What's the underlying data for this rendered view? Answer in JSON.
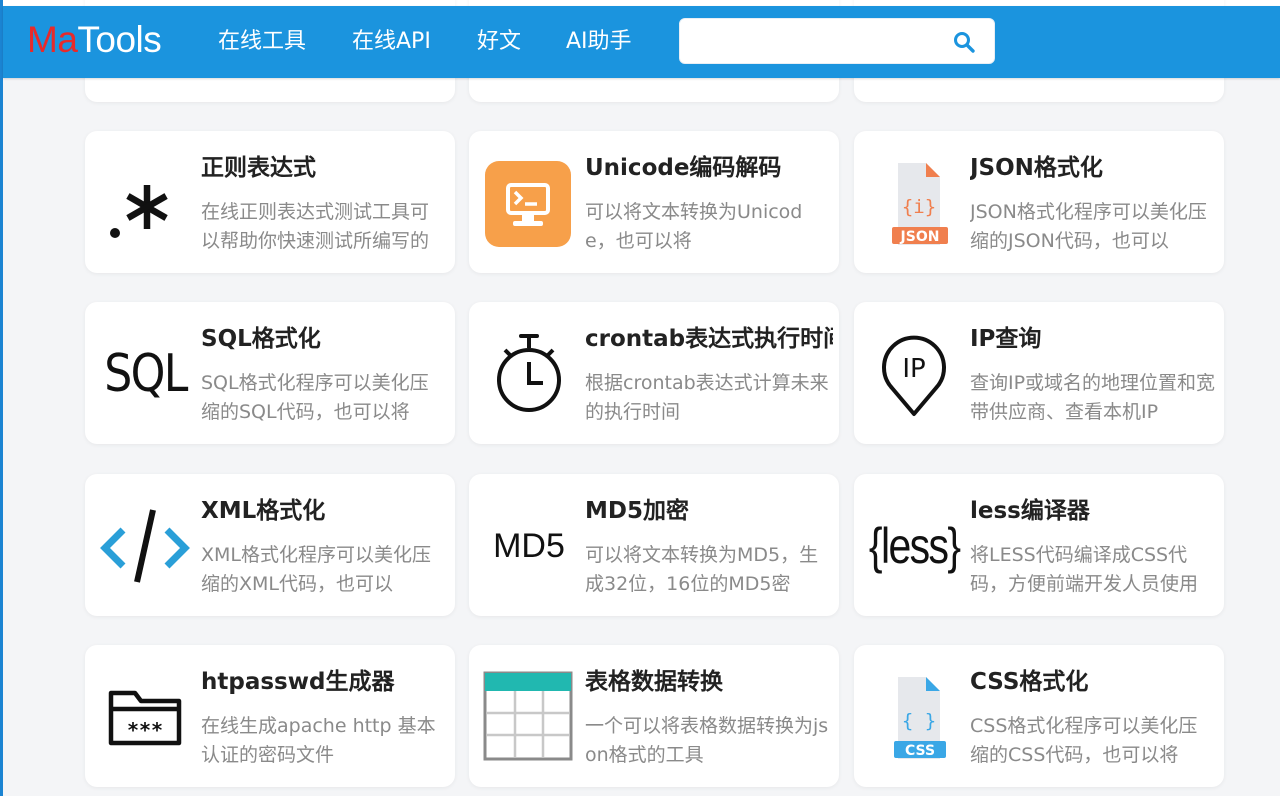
{
  "header": {
    "logo_ma": "Ma",
    "logo_tools": "Tools",
    "nav": [
      "在线工具",
      "在线API",
      "好文",
      "AI助手"
    ],
    "search": {
      "value": "",
      "placeholder": "",
      "icon": "search-icon"
    }
  },
  "partial_row": [
    "",
    "",
    ""
  ],
  "cards": [
    {
      "title": "正则表达式",
      "desc": "在线正则表达式测试工具可以帮助你快速测试所编写的",
      "icon": "regex-icon"
    },
    {
      "title": "Unicode编码解码",
      "desc": "可以将文本转换为Unicode，也可以将",
      "icon": "terminal-icon"
    },
    {
      "title": "JSON格式化",
      "desc": "JSON格式化程序可以美化压缩的JSON代码，也可以",
      "icon": "json-file-icon"
    },
    {
      "title": "SQL格式化",
      "desc": "SQL格式化程序可以美化压缩的SQL代码，也可以将",
      "icon": "sql-icon"
    },
    {
      "title": "crontab表达式执行时间",
      "desc": "根据crontab表达式计算未来的执行时间",
      "icon": "stopwatch-icon"
    },
    {
      "title": "IP查询",
      "desc": "查询IP或域名的地理位置和宽带供应商、查看本机IP",
      "icon": "ip-location-icon"
    },
    {
      "title": "XML格式化",
      "desc": "XML格式化程序可以美化压缩的XML代码，也可以",
      "icon": "xml-code-icon"
    },
    {
      "title": "MD5加密",
      "desc": "可以将文本转换为MD5，生成32位，16位的MD5密",
      "icon": "md5-icon"
    },
    {
      "title": "less编译器",
      "desc": "将LESS代码编译成CSS代码，方便前端开发人员使用",
      "icon": "less-icon"
    },
    {
      "title": "htpasswd生成器",
      "desc": "在线生成apache http 基本认证的密码文件",
      "icon": "password-folder-icon"
    },
    {
      "title": "表格数据转换",
      "desc": "一个可以将表格数据转换为json格式的工具",
      "icon": "table-icon"
    },
    {
      "title": "CSS格式化",
      "desc": "CSS格式化程序可以美化压缩的CSS代码，也可以将",
      "icon": "css-file-icon"
    }
  ],
  "icon_text": {
    "sql": "SQL",
    "md5": "MD5",
    "less": "{less}",
    "json_badge": "JSON",
    "json_glyph": "{i}",
    "css_badge": "CSS",
    "css_glyph": "{ }",
    "ip": "IP",
    "password": "***"
  },
  "colors": {
    "header": "#1b94de",
    "logo_accent": "#e82a2a",
    "orange": "#f7a04a",
    "json_orange": "#f07f4e",
    "css_blue": "#3aa7e6",
    "xml_blue": "#2a9fd8",
    "table_teal": "#21b8b0"
  }
}
